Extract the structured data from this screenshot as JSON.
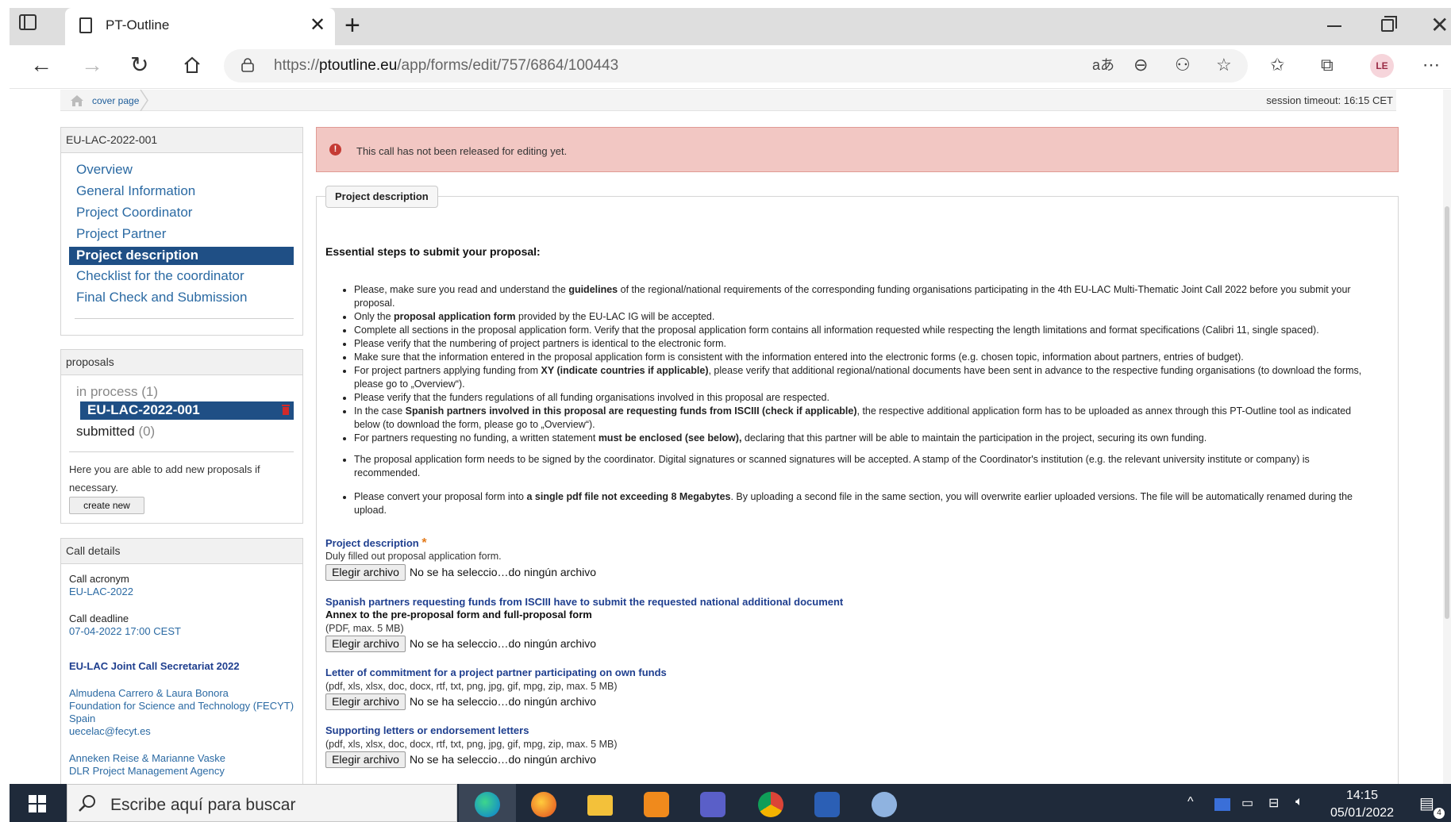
{
  "browser": {
    "tab_title": "PT-Outline",
    "url_prefix": "https://",
    "url_domain": "ptoutline.eu",
    "url_path": "/app/forms/edit/757/6864/100443",
    "profile_initials": "LE"
  },
  "page": {
    "breadcrumb": "cover page",
    "session_timeout": "session timeout: 16:15 CET",
    "alert": "This call has not been released for editing yet.",
    "section_legend": "Project description"
  },
  "sidebar": {
    "project_panel_title": "EU-LAC-2022-001",
    "nav": [
      "Overview",
      "General Information",
      "Project Coordinator",
      "Project Partner",
      "Project description",
      "Checklist for the coordinator",
      "Final Check and Submission"
    ],
    "proposals_panel_title": "proposals",
    "in_process_label": "in process",
    "in_process_count": "(1)",
    "proposal_item": "EU-LAC-2022-001",
    "submitted_label": "submitted",
    "submitted_count": "(0)",
    "add_text": "Here you are able to add new proposals if necessary.",
    "create_button": "create new",
    "call_panel_title": "Call details",
    "call_acronym_label": "Call acronym",
    "call_acronym_value": "EU-LAC-2022",
    "call_deadline_label": "Call deadline",
    "call_deadline_value": "07-04-2022 17:00 CEST",
    "secretariat_title": "EU-LAC Joint Call Secretariat 2022",
    "contact1_names": "Almudena Carrero & Laura Bonora",
    "contact1_org": "Foundation for Science and Technology (FECYT)",
    "contact1_country": "Spain",
    "contact1_email": "uecelac@fecyt.es",
    "contact2_names": "Anneken Reise & Marianne Vaske",
    "contact2_org": "DLR Project Management Agency"
  },
  "main": {
    "steps_title": "Essential steps to submit your proposal:",
    "bullets": [
      {
        "before": "Please, make sure you read and understand the ",
        "bold": "guidelines",
        "after": " of the regional/national requirements of the corresponding funding organisations participating in the 4th EU-LAC Multi-Thematic Joint Call 2022 before you submit your proposal."
      },
      {
        "before": "Only the ",
        "bold": "proposal application form",
        "after": " provided by the EU-LAC IG will be accepted."
      },
      {
        "before": "Complete all sections in the proposal application form. Verify that the proposal application form contains all information requested while respecting the length limitations and format specifications (Calibri 11, single spaced).",
        "bold": "",
        "after": ""
      },
      {
        "before": "Please verify that the numbering of project partners is identical to the electronic form.",
        "bold": "",
        "after": ""
      },
      {
        "before": "Make sure that the information entered in the proposal application form is consistent with the information entered into the electronic forms (e.g. chosen topic, information about partners, entries of budget).",
        "bold": "",
        "after": ""
      },
      {
        "before": "For project partners applying funding from ",
        "bold": "XY (indicate countries if applicable)",
        "after": ", please verify that additional regional/national documents have been sent in advance to the respective funding organisations (to download the forms, please go to „Overview“)."
      },
      {
        "before": "Please verify that the funders regulations of all funding organisations involved in this proposal are respected.",
        "bold": "",
        "after": ""
      },
      {
        "before": "In the case ",
        "bold": "Spanish partners involved in this proposal are requesting funds from ISCIII (check if applicable)",
        "after": ", the respective additional application form has to be uploaded as annex through this PT-Outline tool as indicated below (to download the form, please go to „Overview“)."
      },
      {
        "before": "For partners requesting no funding, a written statement ",
        "bold": "must be enclosed (see below),",
        "after": " declaring that this partner will be able to maintain the participation in the project, securing its own funding."
      },
      {
        "before": "The proposal application form needs to be signed by the coordinator. Digital signatures or scanned signatures will be accepted. A stamp of the Coordinator's institution (e.g. the relevant university institute or company) is recommended.",
        "bold": "",
        "after": ""
      },
      {
        "before": "Please convert your proposal form into ",
        "bold": "a single pdf file not exceeding 8 Megabytes",
        "after": ". By uploading a second file in the same section, you will overwrite earlier uploaded versions. The file will be automatically renamed during the upload."
      }
    ],
    "fields": [
      {
        "title": "Project description",
        "required": "*",
        "sub": "",
        "desc": "Duly filled out proposal application form."
      },
      {
        "title": "Spanish partners requesting funds from ISCIII have to submit the requested national additional document",
        "required": "",
        "sub": "Annex to the pre-proposal form and full-proposal form",
        "desc": "(PDF, max. 5 MB)"
      },
      {
        "title": "Letter of commitment for a project partner participating on own funds",
        "required": "",
        "sub": "",
        "desc": "(pdf, xls, xlsx, doc, docx, rtf, txt, png, jpg, gif, mpg, zip, max. 5 MB)"
      },
      {
        "title": "Supporting letters or endorsement letters",
        "required": "",
        "sub": "",
        "desc": "(pdf, xls, xlsx, doc, docx, rtf, txt, png, jpg, gif, mpg, zip, max. 5 MB)"
      }
    ],
    "file_button": "Elegir archivo",
    "file_none": "No se ha seleccio…do ningún archivo"
  },
  "taskbar": {
    "search_placeholder": "Escribe aquí para buscar",
    "time": "14:15",
    "date": "05/01/2022",
    "notification_count": "4"
  },
  "colors": {
    "nav_active": "#1f4f85",
    "link": "#2b6aa3",
    "alert_bg": "#f2c7c3",
    "field_title": "#1f3f8f",
    "taskbar": "#1f2a3a"
  }
}
